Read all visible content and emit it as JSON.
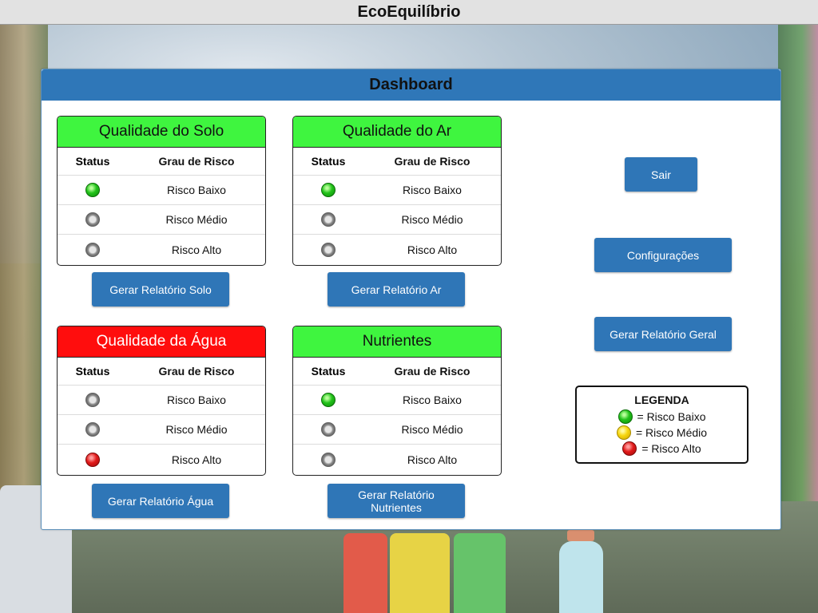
{
  "app": {
    "title": "EcoEquilíbrio"
  },
  "dashboard": {
    "title": "Dashboard"
  },
  "table_headers": {
    "status": "Status",
    "risk": "Grau de Risco"
  },
  "cards": [
    {
      "title": "Qualidade do Solo",
      "header_color": "green",
      "rows": [
        {
          "risk": "Risco Baixo",
          "light": "green"
        },
        {
          "risk": "Risco Médio",
          "light": "off"
        },
        {
          "risk": "Risco Alto",
          "light": "off"
        }
      ],
      "button": "Gerar Relatório Solo"
    },
    {
      "title": "Qualidade do Ar",
      "header_color": "green",
      "rows": [
        {
          "risk": "Risco Baixo",
          "light": "green"
        },
        {
          "risk": "Risco Médio",
          "light": "off"
        },
        {
          "risk": "Risco Alto",
          "light": "off"
        }
      ],
      "button": "Gerar Relatório Ar"
    },
    {
      "title": "Qualidade da Água",
      "header_color": "red",
      "rows": [
        {
          "risk": "Risco Baixo",
          "light": "off"
        },
        {
          "risk": "Risco Médio",
          "light": "off"
        },
        {
          "risk": "Risco Alto",
          "light": "red"
        }
      ],
      "button": "Gerar Relatório Água"
    },
    {
      "title": "Nutrientes",
      "header_color": "green",
      "rows": [
        {
          "risk": "Risco Baixo",
          "light": "green"
        },
        {
          "risk": "Risco Médio",
          "light": "off"
        },
        {
          "risk": "Risco Alto",
          "light": "off"
        }
      ],
      "button_line1": "Gerar Relatório",
      "button_line2": "Nutrientes"
    }
  ],
  "actions": {
    "exit": "Sair",
    "settings": "Configurações",
    "general_report": "Gerar Relatório Geral"
  },
  "legend": {
    "title": "LEGENDA",
    "items": [
      {
        "label": "= Risco Baixo",
        "light": "green"
      },
      {
        "label": "= Risco Médio",
        "light": "yellow"
      },
      {
        "label": "= Risco Alto",
        "light": "red"
      }
    ]
  },
  "colors": {
    "accent": "#2f76b7",
    "status_green": "#3ff53f",
    "status_red": "#ff0d0d"
  }
}
